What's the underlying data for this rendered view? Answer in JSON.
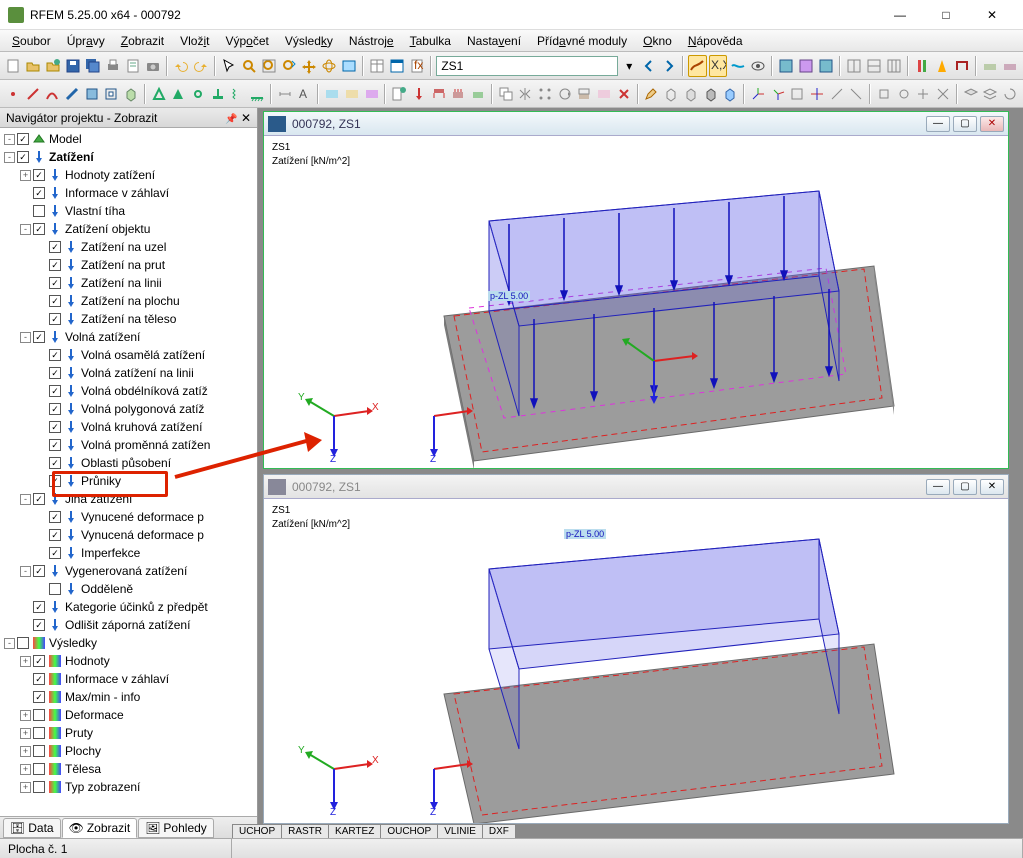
{
  "app": {
    "title": "RFEM 5.25.00 x64 - 000792"
  },
  "menu": [
    "Soubor",
    "Úpravy",
    "Zobrazit",
    "Vložit",
    "Výpočet",
    "Výsledky",
    "Nástroje",
    "Tabulka",
    "Nastavení",
    "Přídavné moduly",
    "Okno",
    "Nápověda"
  ],
  "combo": {
    "value": "ZS1"
  },
  "nav": {
    "title": "Navigátor projektu - Zobrazit",
    "tabs": [
      "Data",
      "Zobrazit",
      "Pohledy"
    ],
    "activeTab": 1,
    "tree": [
      {
        "lvl": 0,
        "exp": "-",
        "ck": true,
        "icon": "model",
        "label": "Model",
        "bold": false
      },
      {
        "lvl": 0,
        "exp": "-",
        "ck": true,
        "icon": "load",
        "label": "Zatížení",
        "bold": true
      },
      {
        "lvl": 1,
        "exp": "+",
        "ck": true,
        "icon": "load",
        "label": "Hodnoty zatížení"
      },
      {
        "lvl": 1,
        "exp": "",
        "ck": true,
        "icon": "load",
        "label": "Informace v záhlaví"
      },
      {
        "lvl": 1,
        "exp": "",
        "ck": false,
        "icon": "load",
        "label": "Vlastní tíha"
      },
      {
        "lvl": 1,
        "exp": "-",
        "ck": true,
        "icon": "load",
        "label": "Zatížení objektu"
      },
      {
        "lvl": 2,
        "exp": "",
        "ck": true,
        "icon": "load",
        "label": "Zatížení na uzel"
      },
      {
        "lvl": 2,
        "exp": "",
        "ck": true,
        "icon": "load",
        "label": "Zatížení na prut"
      },
      {
        "lvl": 2,
        "exp": "",
        "ck": true,
        "icon": "load",
        "label": "Zatížení na linii"
      },
      {
        "lvl": 2,
        "exp": "",
        "ck": true,
        "icon": "load",
        "label": "Zatížení na plochu"
      },
      {
        "lvl": 2,
        "exp": "",
        "ck": true,
        "icon": "load",
        "label": "Zatížení na těleso"
      },
      {
        "lvl": 1,
        "exp": "-",
        "ck": true,
        "icon": "load",
        "label": "Volná zatížení"
      },
      {
        "lvl": 2,
        "exp": "",
        "ck": true,
        "icon": "load",
        "label": "Volná osamělá zatížení"
      },
      {
        "lvl": 2,
        "exp": "",
        "ck": true,
        "icon": "load",
        "label": "Volná zatížení na linii"
      },
      {
        "lvl": 2,
        "exp": "",
        "ck": true,
        "icon": "load",
        "label": "Volná obdélníková zatíž"
      },
      {
        "lvl": 2,
        "exp": "",
        "ck": true,
        "icon": "load",
        "label": "Volná polygonová zatíž"
      },
      {
        "lvl": 2,
        "exp": "",
        "ck": true,
        "icon": "load",
        "label": "Volná kruhová zatížení"
      },
      {
        "lvl": 2,
        "exp": "",
        "ck": true,
        "icon": "load",
        "label": "Volná proměnná zatížen"
      },
      {
        "lvl": 2,
        "exp": "",
        "ck": true,
        "icon": "load",
        "label": "Oblasti působení"
      },
      {
        "lvl": 2,
        "exp": "",
        "ck": true,
        "icon": "load",
        "label": "Průniky",
        "hl": true
      },
      {
        "lvl": 1,
        "exp": "-",
        "ck": true,
        "icon": "load",
        "label": "Jiná zatížení"
      },
      {
        "lvl": 2,
        "exp": "",
        "ck": true,
        "icon": "load",
        "label": "Vynucené deformace p"
      },
      {
        "lvl": 2,
        "exp": "",
        "ck": true,
        "icon": "load",
        "label": "Vynucená deformace p"
      },
      {
        "lvl": 2,
        "exp": "",
        "ck": true,
        "icon": "load",
        "label": "Imperfekce"
      },
      {
        "lvl": 1,
        "exp": "-",
        "ck": true,
        "icon": "load",
        "label": "Vygenerovaná zatížení"
      },
      {
        "lvl": 2,
        "exp": "",
        "ck": false,
        "icon": "load",
        "label": "Odděleně"
      },
      {
        "lvl": 1,
        "exp": "",
        "ck": true,
        "icon": "load",
        "label": "Kategorie účinků z předpět"
      },
      {
        "lvl": 1,
        "exp": "",
        "ck": true,
        "icon": "load",
        "label": "Odlišit záporná zatížení"
      },
      {
        "lvl": 0,
        "exp": "-",
        "ck": false,
        "icon": "res",
        "label": "Výsledky"
      },
      {
        "lvl": 1,
        "exp": "+",
        "ck": true,
        "icon": "res",
        "label": "Hodnoty"
      },
      {
        "lvl": 1,
        "exp": "",
        "ck": true,
        "icon": "res",
        "label": "Informace v záhlaví"
      },
      {
        "lvl": 1,
        "exp": "",
        "ck": true,
        "icon": "res",
        "label": "Max/min - info"
      },
      {
        "lvl": 1,
        "exp": "+",
        "ck": false,
        "icon": "res",
        "label": "Deformace"
      },
      {
        "lvl": 1,
        "exp": "+",
        "ck": false,
        "icon": "res",
        "label": "Pruty"
      },
      {
        "lvl": 1,
        "exp": "+",
        "ck": false,
        "icon": "res",
        "label": "Plochy"
      },
      {
        "lvl": 1,
        "exp": "+",
        "ck": false,
        "icon": "res",
        "label": "Tělesa"
      },
      {
        "lvl": 1,
        "exp": "+",
        "ck": false,
        "icon": "res",
        "label": "Typ zobrazení"
      }
    ]
  },
  "views": [
    {
      "title": "000792, ZS1",
      "overlay": {
        "l1": "ZS1",
        "l2": "Zatížení [kN/m^2]"
      },
      "load_label": "p-ZL 5.00",
      "axisX": "X",
      "axisY": "Y",
      "axisZ": "Z"
    },
    {
      "title": "000792, ZS1",
      "overlay": {
        "l1": "ZS1",
        "l2": "Zatížení [kN/m^2]"
      },
      "load_label": "p-ZL 5.00",
      "axisX": "X",
      "axisY": "Y",
      "axisZ": "Z"
    }
  ],
  "viewTabs": [
    "UCHOP",
    "RASTR",
    "KARTEZ",
    "OUCHOP",
    "VLINIE",
    "DXF"
  ],
  "status": {
    "left": "Plocha č. 1"
  }
}
